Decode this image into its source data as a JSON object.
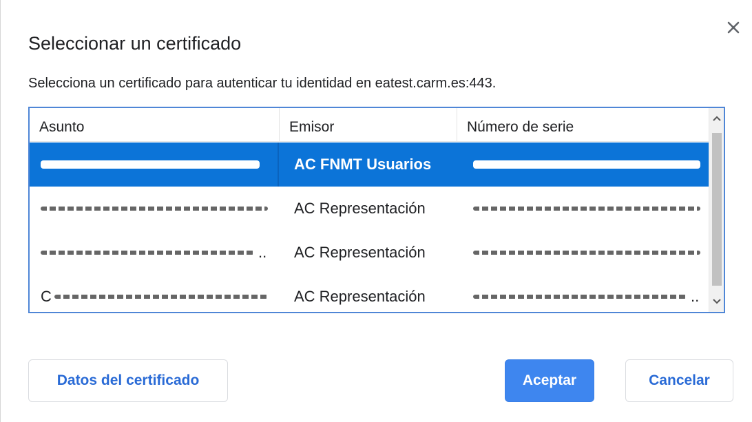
{
  "dialog": {
    "title": "Seleccionar un certificado",
    "description": "Selecciona un certificado para autenticar tu identidad en eatest.carm.es:443.",
    "close_icon": "close-icon"
  },
  "table": {
    "columns": [
      "Asunto",
      "Emisor",
      "Número de serie"
    ],
    "rows": [
      {
        "subject": "",
        "issuer": "AC FNMT Usuarios",
        "serial": "",
        "selected": true
      },
      {
        "subject": "",
        "issuer": "AC Representación",
        "serial": "",
        "selected": false
      },
      {
        "subject": "",
        "issuer": "AC Representación",
        "serial": "",
        "selected": false
      },
      {
        "subject": "C",
        "issuer": "AC Representación",
        "serial": "",
        "selected": false
      }
    ],
    "ellipsis": "..",
    "scroll_up_icon": "chevron-up-icon",
    "scroll_down_icon": "chevron-down-icon"
  },
  "buttons": {
    "details": "Datos del certificado",
    "accept": "Aceptar",
    "cancel": "Cancelar"
  },
  "colors": {
    "selected_row": "#0c74d8",
    "primary_button": "#3e86ef",
    "link_text": "#2a6bd6",
    "table_border": "#4f86d6"
  }
}
